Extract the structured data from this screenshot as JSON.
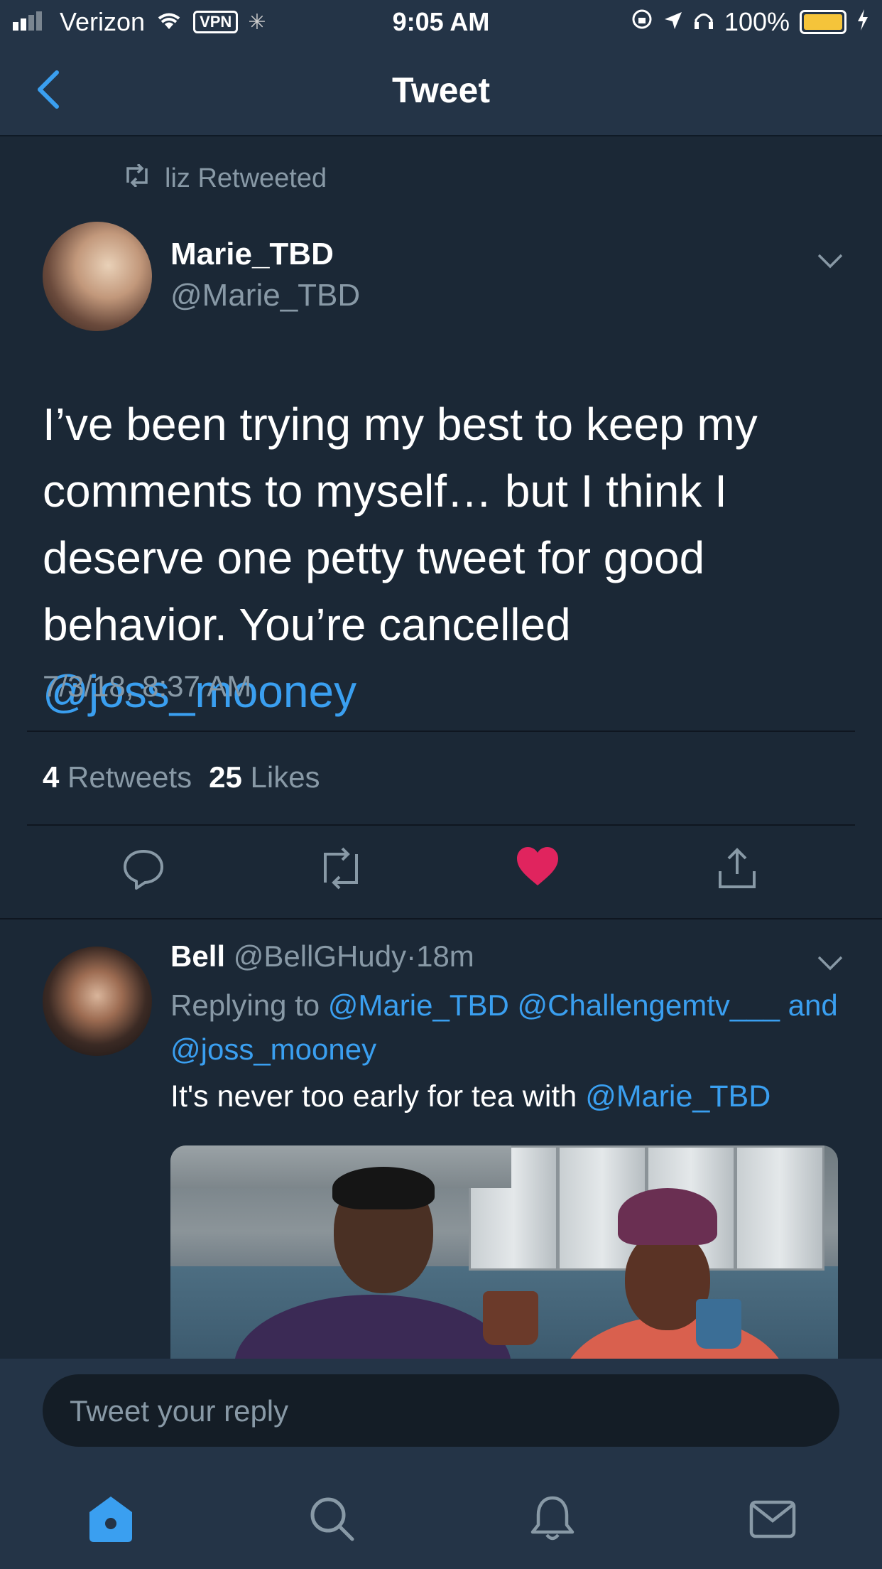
{
  "status_bar": {
    "carrier": "Verizon",
    "vpn": "VPN",
    "time": "9:05 AM",
    "battery": "100%"
  },
  "nav": {
    "title": "Tweet"
  },
  "tweet": {
    "retweeted_by": "liz Retweeted",
    "author_name": "Marie_TBD",
    "author_handle": "@Marie_TBD",
    "text_plain": "I’ve been trying my best to keep my comments to myself… but I think I deserve one petty tweet for good behavior. You’re cancelled ",
    "text_mention": "@joss_mooney",
    "timestamp": "7/3/18, 8:37 AM",
    "retweets_count": "4",
    "retweets_label": "Retweets",
    "likes_count": "25",
    "likes_label": "Likes",
    "liked": true
  },
  "reply": {
    "author_name": "Bell",
    "author_handle": "@BellGHudy",
    "dot": "·",
    "age": "18m",
    "replying_prefix": "Replying to ",
    "replying_mention_1": "@Marie_TBD",
    "replying_mention_2": "@Challengemtv___",
    "replying_and": "and ",
    "replying_mention_3": "@joss_mooney",
    "text_plain": "It's never too early for tea with ",
    "text_mention": "@Marie_TBD"
  },
  "compose": {
    "placeholder": "Tweet your reply"
  },
  "colors": {
    "background": "#1b2836",
    "bar": "#243447",
    "link": "#3a9ff0",
    "muted": "#8899a6",
    "like": "#e0245e"
  }
}
